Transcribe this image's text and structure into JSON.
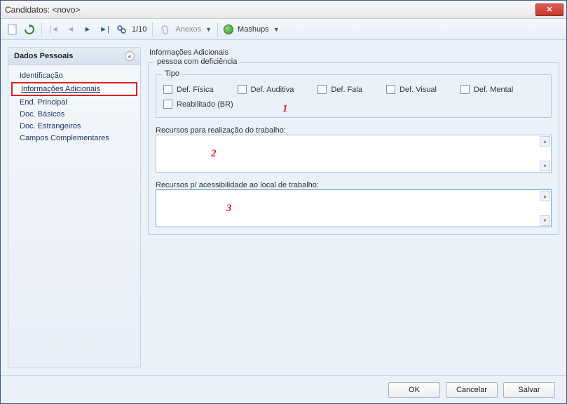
{
  "window": {
    "title": "Candidatos: <novo>"
  },
  "toolbar": {
    "page_indicator": "1/10",
    "anexos_label": "Anexos",
    "mashups_label": "Mashups"
  },
  "sidebar": {
    "header": "Dados Pessoais",
    "items": [
      {
        "label": "Identificação"
      },
      {
        "label": "Informações Adicionais"
      },
      {
        "label": "End. Principal"
      },
      {
        "label": "Doc. Básicos"
      },
      {
        "label": "Doc. Estrangeiros"
      },
      {
        "label": "Campos Complementares"
      }
    ],
    "selected_index": 1
  },
  "main": {
    "section_title": "Informações Adicionais",
    "group1": {
      "label": "pessoa com deficiência",
      "tipo_label": "Tipo",
      "checks": [
        {
          "label": "Def. Física"
        },
        {
          "label": "Def. Auditiva"
        },
        {
          "label": "Def. Fala"
        },
        {
          "label": "Def. Visual"
        },
        {
          "label": "Def. Mental"
        },
        {
          "label": "Reabilitado (BR)"
        }
      ]
    },
    "field1_label": "Recursos para realização do trabalho:",
    "field2_label": "Recursos p/ acessibilidade ao local de trabalho:"
  },
  "annotations": {
    "a1": "1",
    "a2": "2",
    "a3": "3"
  },
  "footer": {
    "ok": "OK",
    "cancel": "Cancelar",
    "save": "Salvar"
  }
}
